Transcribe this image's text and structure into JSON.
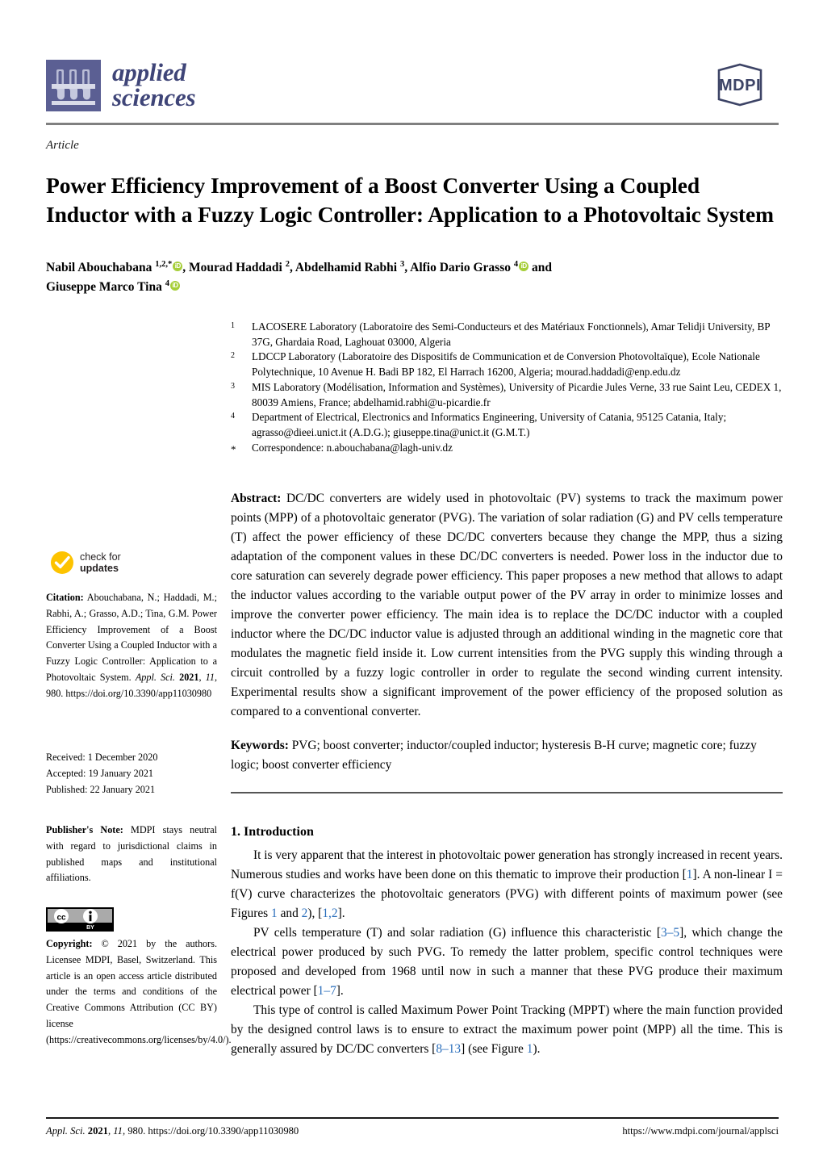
{
  "header": {
    "journal_name_line1": "applied",
    "journal_name_line2": "sciences",
    "publisher_logo_text": "MDPI",
    "logo_icon": "test-tube-rack-icon",
    "brand_color": "#3f4578",
    "mdpi_color": "#3d4466"
  },
  "article": {
    "type": "Article",
    "title": "Power Efficiency Improvement of a Boost Converter Using a Coupled Inductor with a Fuzzy Logic Controller: Application to a Photovoltaic System"
  },
  "authors": {
    "line1_parts": [
      {
        "name": "Nabil Abouchabana",
        "sup": "1,2,*",
        "orcid": true,
        "sep": ", "
      },
      {
        "name": "Mourad Haddadi",
        "sup": "2",
        "orcid": false,
        "sep": ", "
      },
      {
        "name": "Abdelhamid Rabhi",
        "sup": "3",
        "orcid": false,
        "sep": ", "
      },
      {
        "name": "Alfio Dario Grasso",
        "sup": "4",
        "orcid": true,
        "sep": " and"
      }
    ],
    "line2_parts": [
      {
        "name": "Giuseppe Marco Tina",
        "sup": "4",
        "orcid": true,
        "sep": ""
      }
    ],
    "orcid_glyph": "iD",
    "orcid_color": "#a6ce39"
  },
  "affiliations": [
    {
      "num": "1",
      "text": "LACOSERE Laboratory (Laboratoire des Semi-Conducteurs et des Matériaux Fonctionnels), Amar Telidji University, BP 37G, Ghardaia Road, Laghouat 03000, Algeria"
    },
    {
      "num": "2",
      "text": "LDCCP Laboratory (Laboratoire des Dispositifs de Communication et de Conversion Photovoltaïque), Ecole Nationale Polytechnique, 10 Avenue H. Badi BP 182, El Harrach 16200, Algeria; mourad.haddadi@enp.edu.dz"
    },
    {
      "num": "3",
      "text": "MIS Laboratory (Modélisation, Information and Systèmes), University of Picardie Jules Verne, 33 rue Saint Leu, CEDEX 1, 80039 Amiens, France; abdelhamid.rabhi@u-picardie.fr"
    },
    {
      "num": "4",
      "text": "Department of Electrical, Electronics and Informatics Engineering, University of Catania, 95125 Catania, Italy; agrasso@dieei.unict.it (A.D.G.); giuseppe.tina@unict.it (G.M.T.)"
    },
    {
      "num": "*",
      "text": "Correspondence: n.abouchabana@lagh-univ.dz"
    }
  ],
  "abstract": {
    "label": "Abstract:",
    "text": "DC/DC converters are widely used in photovoltaic (PV) systems to track the maximum power points (MPP) of a photovoltaic generator (PVG). The variation of solar radiation (G) and PV cells temperature (T) affect the power efficiency of these DC/DC converters because they change the MPP, thus a sizing adaptation of the component values in these DC/DC converters is needed. Power loss in the inductor due to core saturation can severely degrade power efficiency. This paper proposes a new method that allows to adapt the inductor values according to the variable output power of the PV array in order to minimize losses and improve the converter power efficiency. The main idea is to replace the DC/DC inductor with a coupled inductor where the DC/DC inductor value is adjusted through an additional winding in the magnetic core that modulates the magnetic field inside it. Low current intensities from the PVG supply this winding through a circuit controlled by a fuzzy logic controller in order to regulate the second winding current intensity. Experimental results show a significant improvement of the power efficiency of the proposed solution as compared to a conventional converter."
  },
  "keywords": {
    "label": "Keywords:",
    "text": "PVG; boost converter; inductor/coupled inductor; hysteresis B-H curve; magnetic core; fuzzy logic; boost converter efficiency"
  },
  "section": {
    "heading": "1. Introduction",
    "paragraphs": [
      {
        "segments": [
          {
            "t": "It is very apparent that the interest in photovoltaic power generation has strongly increased in recent years. Numerous studies and works have been done on this thematic to improve their production ["
          },
          {
            "t": "1",
            "ref": true
          },
          {
            "t": "]. A non-linear I = f(V) curve characterizes the photovoltaic generators (PVG) with different points of maximum power (see Figures "
          },
          {
            "t": "1",
            "ref": true
          },
          {
            "t": " and "
          },
          {
            "t": "2",
            "ref": true
          },
          {
            "t": "), ["
          },
          {
            "t": "1,2",
            "ref": true
          },
          {
            "t": "]."
          }
        ]
      },
      {
        "segments": [
          {
            "t": "PV cells temperature (T) and solar radiation (G) influence this characteristic ["
          },
          {
            "t": "3–5",
            "ref": true
          },
          {
            "t": "], which change the electrical power produced by such PVG. To remedy the latter problem, specific control techniques were proposed and developed from 1968 until now in such a manner that these PVG produce their maximum electrical power ["
          },
          {
            "t": "1–7",
            "ref": true
          },
          {
            "t": "]."
          }
        ]
      },
      {
        "segments": [
          {
            "t": "This type of control is called Maximum Power Point Tracking (MPPT) where the main function provided by the designed control laws is to ensure to extract the maximum power point (MPP) all the time. This is generally assured by DC/DC converters ["
          },
          {
            "t": "8–13",
            "ref": true
          },
          {
            "t": "] (see Figure "
          },
          {
            "t": "1",
            "ref": true
          },
          {
            "t": ")."
          }
        ]
      }
    ]
  },
  "sidebar": {
    "check_updates": {
      "line1": "check for",
      "line2": "updates",
      "icon": "check-circle-icon",
      "color": "#FDC300"
    },
    "citation": {
      "label": "Citation:",
      "text_before_italic": " Abouchabana, N.; Haddadi, M.; Rabhi, A.; Grasso, A.D.; Tina, G.M. Power Efficiency Improvement of a Boost Converter Using a Coupled Inductor with a Fuzzy Logic Controller: Application to a Photovoltaic System. ",
      "journal_italic": "Appl. Sci.",
      "year": "2021",
      "volume": "11",
      "article_no": "980",
      "doi": "https://doi.org/10.3390/app11030980"
    },
    "dates": [
      "Received: 1 December 2020",
      "Accepted: 19 January 2021",
      "Published: 22 January 2021"
    ],
    "publisher_note": {
      "label": "Publisher's Note:",
      "text": " MDPI stays neutral with regard to jurisdictional claims in published maps and institutional affiliations."
    },
    "copyright": {
      "label": "Copyright:",
      "text": " © 2021 by the authors. Licensee MDPI, Basel, Switzerland. This article is an open access article distributed under the terms and conditions of the Creative Commons Attribution (CC BY) license (https://creativecommons.org/licenses/by/4.0/).",
      "license_icon": "creative-commons-by-icon"
    }
  },
  "footer": {
    "left_journal": "Appl. Sci.",
    "left_year": "2021",
    "left_volume": "11",
    "left_article": "980",
    "left_doi": "https://doi.org/10.3390/app11030980",
    "right_url": "https://www.mdpi.com/journal/applsci"
  }
}
